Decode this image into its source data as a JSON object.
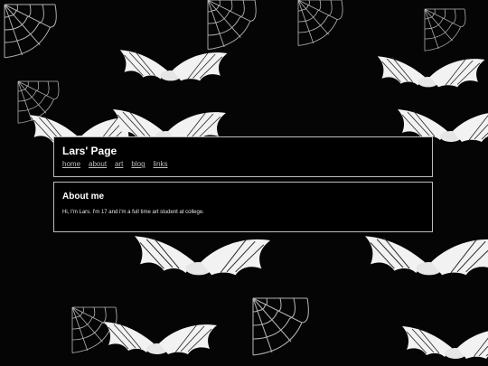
{
  "header": {
    "title": "Lars' Page",
    "nav": [
      {
        "label": "home"
      },
      {
        "label": "about"
      },
      {
        "label": "art"
      },
      {
        "label": "blog"
      },
      {
        "label": "links"
      }
    ]
  },
  "about": {
    "heading": "About me",
    "text": "Hi, I'm Lars. I'm 17 and i'm a full time art student at college."
  },
  "background": {
    "motif": "bats-and-spiderwebs",
    "colors": {
      "base": "#000000",
      "art": "#ffffff",
      "border": "#bdbdbd"
    }
  }
}
